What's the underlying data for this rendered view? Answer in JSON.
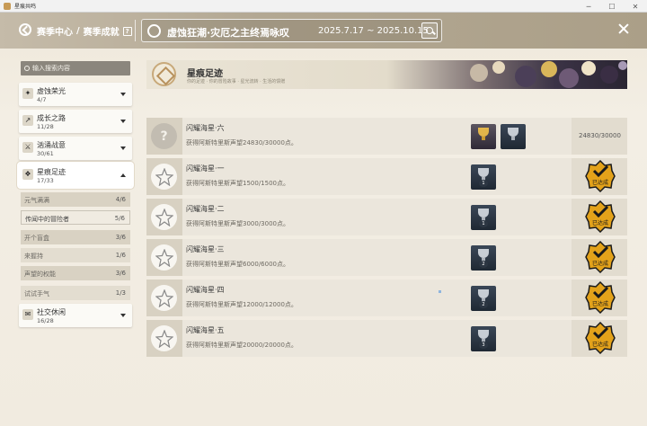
{
  "window": {
    "title": "星痕共鸣",
    "btn_min": "─",
    "btn_max": "☐",
    "btn_close": "✕"
  },
  "header": {
    "breadcrumb_home": "赛季中心",
    "breadcrumb_sep": "/",
    "breadcrumb_current": "赛季成就",
    "help_label": "?",
    "season_title": "虚蚀狂潮·灾厄之主终焉咏叹",
    "season_dates": "2025.7.17 ~ 2025.10.15"
  },
  "sidebar": {
    "search_placeholder": "输入搜索内容",
    "categories": [
      {
        "name": "虚蚀荣光",
        "count": "4/7",
        "icon": "badge-icon"
      },
      {
        "name": "成长之路",
        "count": "11/28",
        "icon": "growth-icon"
      },
      {
        "name": "汹涌战意",
        "count": "30/61",
        "icon": "swords-icon"
      },
      {
        "name": "星痕足迹",
        "count": "17/33",
        "icon": "footprint-icon"
      },
      {
        "name": "社交休闲",
        "count": "16/28",
        "icon": "chat-icon"
      }
    ],
    "subcategories": [
      {
        "name": "元气满满",
        "count": "4/6"
      },
      {
        "name": "传闻中的冒险者",
        "count": "5/6"
      },
      {
        "name": "开个盲盒",
        "count": "3/6"
      },
      {
        "name": "来握持",
        "count": "1/6"
      },
      {
        "name": "声望的权能",
        "count": "3/6"
      },
      {
        "name": "试试手气",
        "count": "1/3"
      }
    ]
  },
  "banner": {
    "title": "星痕足迹",
    "subtitle": "你的足迹 · 你的冒险故事 · 星光流转 · 生活的馈赠"
  },
  "achievements": [
    {
      "title": "闪耀海星·六",
      "desc": "获得阿斯特里斯声望24830/30000点。",
      "status": "in_progress",
      "progress": "24830/30000",
      "trophies": [
        {
          "tier": "gold",
          "num": ""
        },
        {
          "tier": "silver",
          "num": ""
        }
      ]
    },
    {
      "title": "闪耀海星·一",
      "desc": "获得阿斯特里斯声望1500/1500点。",
      "status": "claimed",
      "trophies": [
        {
          "tier": "silver",
          "num": "1"
        }
      ]
    },
    {
      "title": "闪耀海星·二",
      "desc": "获得阿斯特里斯声望3000/3000点。",
      "status": "claimed",
      "trophies": [
        {
          "tier": "silver",
          "num": "1"
        }
      ]
    },
    {
      "title": "闪耀海星·三",
      "desc": "获得阿斯特里斯声望6000/6000点。",
      "status": "claimed",
      "trophies": [
        {
          "tier": "silver",
          "num": "2"
        }
      ]
    },
    {
      "title": "闪耀海星·四",
      "desc": "获得阿斯特里斯声望12000/12000点。",
      "status": "claimed",
      "trophies": [
        {
          "tier": "silver",
          "num": "2"
        }
      ]
    },
    {
      "title": "闪耀海星·五",
      "desc": "获得阿斯特里斯声望20000/20000点。",
      "status": "claimed",
      "trophies": [
        {
          "tier": "silver",
          "num": "3"
        }
      ]
    }
  ],
  "claimed_label": "已达成",
  "colors": {
    "accent_gold": "#e2b54a",
    "stamp": "#e3a21a",
    "panel": "#ebe6dc"
  }
}
